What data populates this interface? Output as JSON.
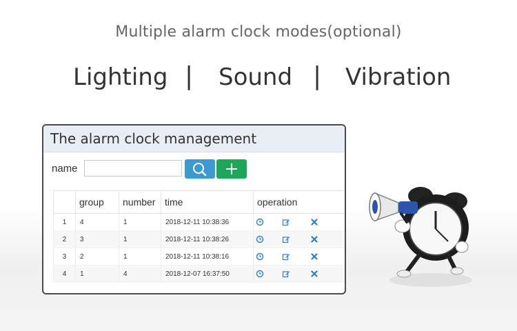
{
  "headline": {
    "subtitle": "Multiple alarm clock modes(optional)",
    "modes": [
      "Lighting",
      "Sound",
      "Vibration"
    ],
    "separator": "|"
  },
  "panel": {
    "title": "The alarm clock management",
    "search": {
      "label": "name",
      "value": "",
      "placeholder": ""
    },
    "buttons": {
      "search_icon": "search-icon",
      "add_icon": "plus-icon"
    },
    "columns": [
      "",
      "group",
      "number",
      "time",
      "operation"
    ],
    "rows": [
      {
        "index": "1",
        "group": "4",
        "number": "1",
        "time": "2018-12-11 10:38:36"
      },
      {
        "index": "2",
        "group": "3",
        "number": "1",
        "time": "2018-12-11 10:38:26"
      },
      {
        "index": "3",
        "group": "2",
        "number": "1",
        "time": "2018-12-11 10:38:16"
      },
      {
        "index": "4",
        "group": "1",
        "number": "4",
        "time": "2018-12-07 16:37:50"
      }
    ],
    "operation_icons": [
      "clock-icon",
      "edit-icon",
      "delete-icon"
    ]
  },
  "colors": {
    "search_button": "#3d9ad1",
    "add_button": "#1ea65a",
    "icon_blue": "#2f7fc0"
  },
  "illustration": "alarm-clock-mascot-with-megaphone"
}
